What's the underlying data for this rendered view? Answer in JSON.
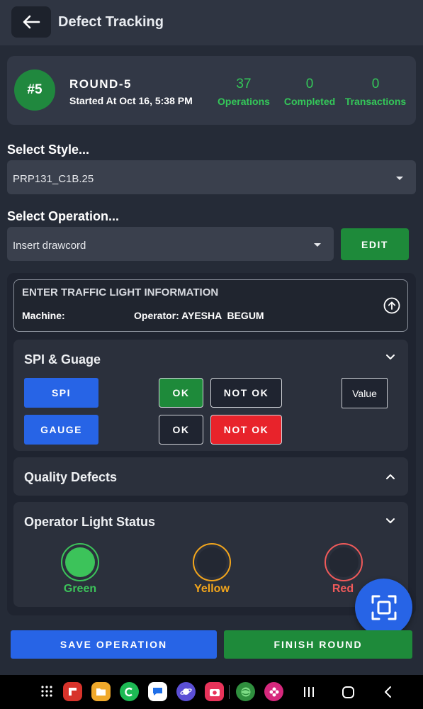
{
  "header": {
    "title": "Defect Tracking",
    "back_icon": "arrow-left-icon"
  },
  "round": {
    "badge": "#5",
    "name": "ROUND-5",
    "started": "Started At Oct 16, 5:38 PM",
    "stats": [
      {
        "value": "37",
        "label": "Operations"
      },
      {
        "value": "0",
        "label": "Completed"
      },
      {
        "value": "0",
        "label": "Transactions"
      }
    ]
  },
  "style_select": {
    "label": "Select Style...",
    "value": "PRP131_C1B.25"
  },
  "operation_select": {
    "label": "Select Operation...",
    "value": "Insert drawcord",
    "edit_label": "EDIT"
  },
  "traffic": {
    "title": "ENTER TRAFFIC LIGHT INFORMATION",
    "machine": "Machine:",
    "operator": "Operator: AYESHA  BEGUM"
  },
  "spi_section": {
    "title": "SPI & Guage",
    "spi_label": "SPI",
    "gauge_label": "GAUGE",
    "ok_label": "OK",
    "not_ok_label": "NOT OK",
    "value_label": "Value"
  },
  "quality": {
    "title": "Quality Defects"
  },
  "operator_light": {
    "title": "Operator Light Status",
    "lights": [
      {
        "label": "Green",
        "color": "#3cc35a"
      },
      {
        "label": "Yellow",
        "color": "#f2a51c"
      },
      {
        "label": "Red",
        "color": "#f05a5a"
      }
    ]
  },
  "footer": {
    "save_label": "SAVE OPERATION",
    "finish_label": "FINISH ROUND"
  },
  "colors": {
    "background": "#252b37",
    "green": "#1e8a3a",
    "blue": "#2764e6",
    "red": "#e8232b",
    "stat_green": "#34c759"
  }
}
